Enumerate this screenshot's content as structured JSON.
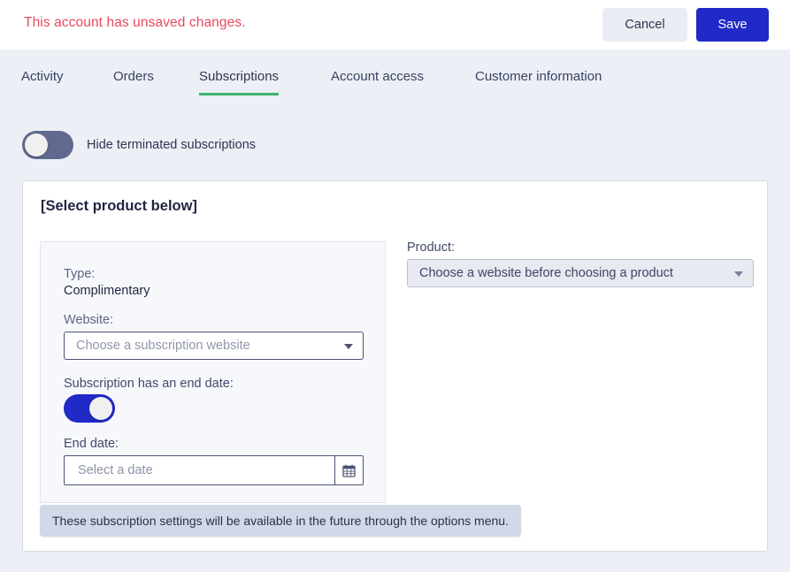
{
  "topbar": {
    "alert": "This account has unsaved changes.",
    "cancel_label": "Cancel",
    "save_label": "Save"
  },
  "tabs": [
    {
      "label": "Activity",
      "active": false
    },
    {
      "label": "Orders",
      "active": false
    },
    {
      "label": "Subscriptions",
      "active": true
    },
    {
      "label": "Account access",
      "active": false
    },
    {
      "label": "Customer information",
      "active": false
    }
  ],
  "filter": {
    "hide_terminated_label": "Hide terminated subscriptions",
    "hide_terminated_state": "off"
  },
  "card": {
    "title": "[Select product below]",
    "panel": {
      "type_label": "Type:",
      "type_value": "Complimentary",
      "website_label": "Website:",
      "website_value": "Choose a subscription website",
      "end_date_toggle_label": "Subscription has an end date:",
      "end_date_toggle_state": "on",
      "end_date_label": "End date:",
      "end_date_placeholder": "Select a date",
      "end_date_value": "",
      "calendar_icon": "calendar-icon"
    },
    "product": {
      "label": "Product:",
      "value": "Choose a website before choosing a product"
    }
  },
  "tooltip": {
    "text": "These subscription settings will be available in the future through the options menu."
  },
  "colors": {
    "accent_blue": "#2129c6",
    "tab_underline_green": "#3cb46e",
    "alert_red": "#e8495f",
    "page_background": "#eceff5",
    "toggle_off_track": "#606a8f"
  }
}
